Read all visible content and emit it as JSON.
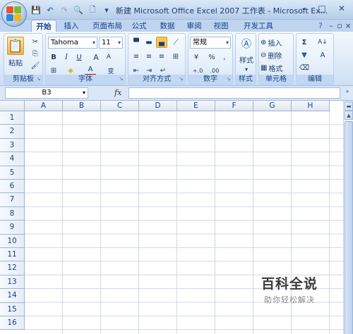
{
  "window": {
    "title": "新建 Microsoft Office Excel 2007 工作表 - Microsoft Ex...",
    "minimize": "–",
    "maximize": "□",
    "close": "✕"
  },
  "qat": {
    "save": "💾",
    "undo": "↶",
    "redo": "↷",
    "print_preview": "🔍",
    "new": "🗋",
    "customize": "▾"
  },
  "tabs": [
    "开始",
    "插入",
    "页面布局",
    "公式",
    "数据",
    "审阅",
    "视图",
    "开发工具"
  ],
  "active_tab": "开始",
  "ribbon": {
    "clipboard": {
      "label": "剪贴板",
      "paste": "粘贴",
      "cut": "✂",
      "copy": "⎘",
      "format_painter": "🖌"
    },
    "font": {
      "label": "字体",
      "family": "Tahoma",
      "size": "11",
      "bold": "B",
      "italic": "I",
      "underline": "U",
      "grow": "A",
      "shrink": "A",
      "border": "⊞",
      "fill": "◈",
      "font_color": "A",
      "phonetic": "变"
    },
    "alignment": {
      "label": "对齐方式"
    },
    "number": {
      "label": "数字",
      "format": "常规",
      "currency": "¥",
      "percent": "%",
      "comma": ",",
      "inc_decimal": "+.0",
      "dec_decimal": ".00"
    },
    "styles": {
      "label": "样式",
      "button": "样式"
    },
    "cells": {
      "label": "单元格",
      "insert": "插入",
      "delete": "删除",
      "format": "格式"
    },
    "editing": {
      "label": "编辑",
      "sum": "Σ",
      "sort": "A↓",
      "fill": "▼",
      "find": "A",
      "clear": "⌫"
    }
  },
  "formula_bar": {
    "name_box": "B3",
    "fx": "fx",
    "value": ""
  },
  "sheet": {
    "columns": [
      "A",
      "B",
      "C",
      "D",
      "E",
      "F",
      "G",
      "H"
    ],
    "rows": [
      "1",
      "2",
      "3",
      "4",
      "5",
      "6",
      "7",
      "8",
      "9",
      "10",
      "11",
      "12",
      "13",
      "14",
      "15",
      "16"
    ]
  },
  "watermark": {
    "title": "百科全说",
    "subtitle": "助你轻松解决"
  },
  "colors": {
    "accent": "#15428b",
    "ribbon_bg": "#dde9f7",
    "grid_line": "#d0d7e5",
    "font_color_underline": "#e00000"
  }
}
